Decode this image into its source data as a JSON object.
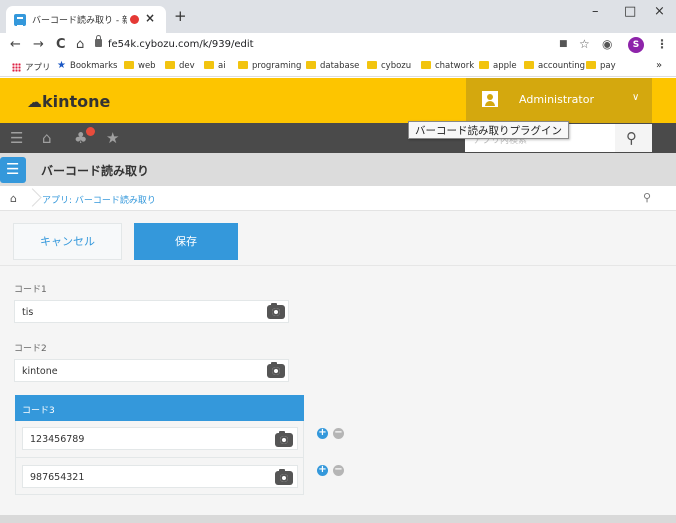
{
  "browser": {
    "tab_title": "バーコード読み取り - 新しいレコー",
    "tab_close": "×",
    "new_tab": "+",
    "window": {
      "minimize": "–",
      "maximize": "□",
      "close": "×"
    },
    "nav": {
      "back": "←",
      "forward": "→",
      "reload": "C",
      "home": "⌂"
    },
    "url": "fe54k.cybozu.com/k/939/edit",
    "toolbar_icons": {
      "cast": "■",
      "star": "☆",
      "extension": "◉",
      "menu": "⋮"
    },
    "profile_initial": "S",
    "bookmarks": [
      {
        "label": "アプリ",
        "icon": "apps-grid-icon"
      },
      {
        "label": "Bookmarks",
        "icon": "star-icon"
      },
      {
        "label": "web",
        "icon": "folder-icon"
      },
      {
        "label": "dev",
        "icon": "folder-icon"
      },
      {
        "label": "ai",
        "icon": "folder-icon"
      },
      {
        "label": "programing",
        "icon": "folder-icon"
      },
      {
        "label": "database",
        "icon": "folder-icon"
      },
      {
        "label": "cybozu",
        "icon": "folder-icon"
      },
      {
        "label": "chatwork",
        "icon": "folder-icon"
      },
      {
        "label": "apple",
        "icon": "folder-icon"
      },
      {
        "label": "accounting",
        "icon": "folder-icon"
      },
      {
        "label": "pay",
        "icon": "folder-icon"
      }
    ],
    "bookmarks_overflow": "»"
  },
  "kintone": {
    "logo": "kintone",
    "user_name": "Administrator",
    "user_chevron": "∨",
    "search_placeholder": "アプリ内検索",
    "search_icon": "⚲",
    "tooltip": "バーコード読み取りプラグイン",
    "app_title": "バーコード読み取り",
    "breadcrumb": "アプリ: バーコード読み取り",
    "pin_icon": "⚲",
    "cancel_label": "キャンセル",
    "save_label": "保存"
  },
  "form": {
    "code1": {
      "label": "コード1",
      "value": "tis"
    },
    "code2": {
      "label": "コード2",
      "value": "kintone"
    },
    "code3": {
      "label": "コード3",
      "rows": [
        {
          "value": "123456789"
        },
        {
          "value": "987654321"
        }
      ]
    }
  },
  "colors": {
    "header_yellow": "#fdc500",
    "accent_blue": "#3498db",
    "nav_dark": "#4a4a4a"
  }
}
